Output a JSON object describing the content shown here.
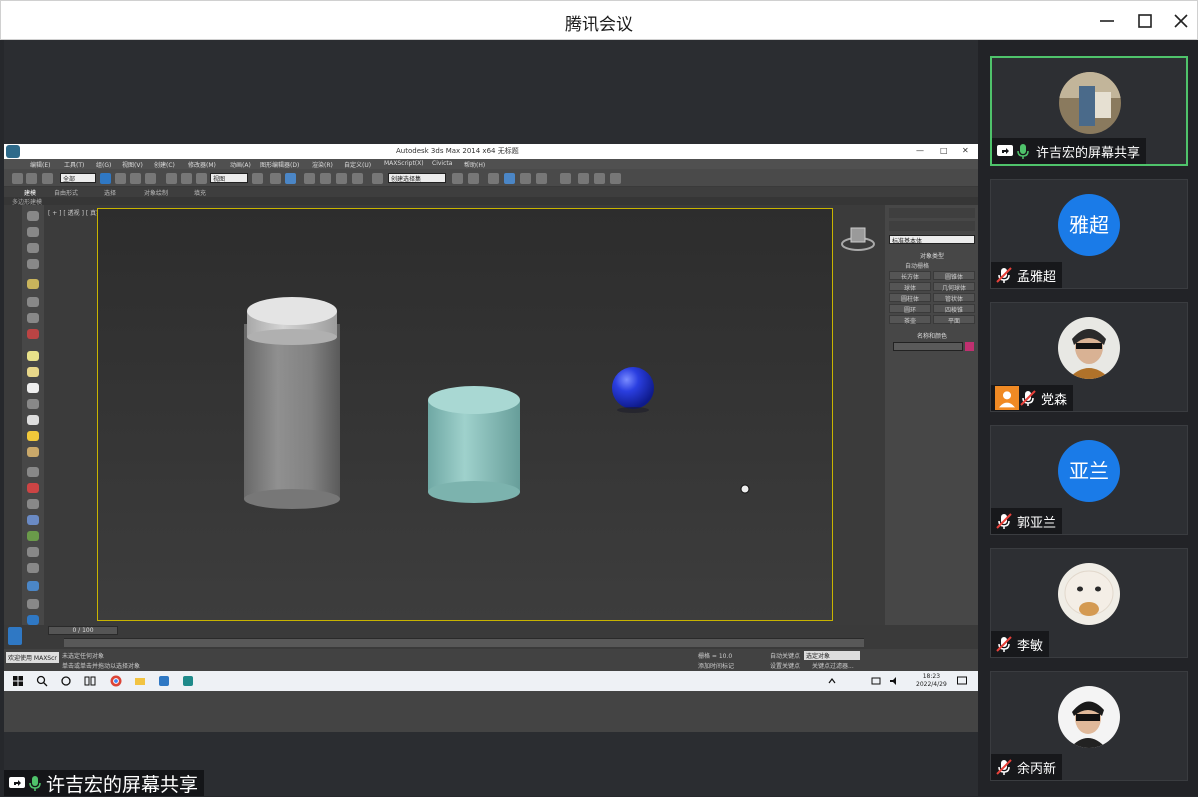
{
  "window": {
    "title": "腾讯会议"
  },
  "shared_screen": {
    "app_title": "Autodesk 3ds Max  2014 x64      无标题",
    "menus": [
      "编辑(E)",
      "工具(T)",
      "组(G)",
      "视图(V)",
      "创建(C)",
      "修改器(M)",
      "动画(A)",
      "图形编辑器(D)",
      "渲染(R)",
      "自定义(U)",
      "MAXScript(X)",
      "Civicta",
      "帮助(H)"
    ],
    "toolbar_dropdown_all": "全部",
    "toolbar_dropdown_view": "视图",
    "toolbar_dropdown_sel": "创建选择集",
    "ribbon_tabs": [
      "建模",
      "自由形式",
      "选择",
      "对象绘制",
      "填充"
    ],
    "ribbon_sub": "多边形建模",
    "viewport_label": "[ + ] [ 透视 ] [ 真实 ]",
    "command_panel": {
      "dropdown": "标准基本体",
      "section": "对象类型",
      "autogrid": "自动栅格",
      "buttons": [
        "长方体",
        "圆锥体",
        "球体",
        "几何球体",
        "圆柱体",
        "管状体",
        "圆环",
        "四棱锥",
        "茶壶",
        "平面"
      ],
      "section2": "名称和颜色"
    },
    "timeline_frame": "0 / 100",
    "status": {
      "line1": "未选定任何对象",
      "line2": "单击或单击并拖动以选择对象",
      "welcome": "欢迎使用  MAXScr",
      "grid": "栅格 = 10.0",
      "autokey": "自动关键点",
      "setkey": "设置关键点",
      "selected": "选定对象",
      "addtime": "添加时间标记",
      "keyfilter": "关键点过滤器..."
    },
    "taskbar_clock": {
      "time": "18:23",
      "date": "2022/4/29"
    }
  },
  "sharer_label": "许吉宏的屏幕共享",
  "participants": [
    {
      "name": "许吉宏的屏幕共享",
      "type": "photo",
      "active": true,
      "mic": "on",
      "share": true
    },
    {
      "name": "孟雅超",
      "type": "text",
      "avatar_text": "雅超",
      "mic": "muted"
    },
    {
      "name": "党森",
      "type": "photo",
      "mic": "muted",
      "host": true
    },
    {
      "name": "郭亚兰",
      "type": "text",
      "avatar_text": "亚兰",
      "mic": "muted"
    },
    {
      "name": "李敏",
      "type": "photo",
      "mic": "muted"
    },
    {
      "name": "余丙新",
      "type": "photo",
      "mic": "muted"
    }
  ],
  "colors": {
    "accent_green": "#4fc36b",
    "avatar_blue": "#1a7be8",
    "muted_red": "#e8413a",
    "viewport_border": "#c8b400"
  }
}
